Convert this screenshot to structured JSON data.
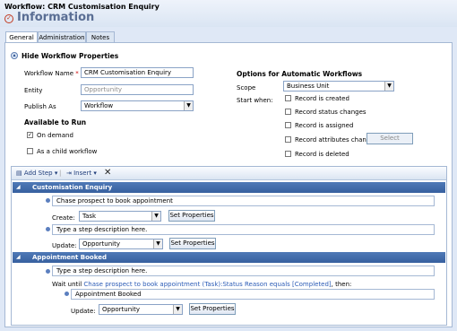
{
  "header": {
    "workflow_title": "Workflow: CRM Customisation Enquiry",
    "info_title": "Information"
  },
  "tabs": [
    {
      "label": "General"
    },
    {
      "label": "Administration"
    },
    {
      "label": "Notes"
    }
  ],
  "properties": {
    "section_label": "Hide Workflow Properties",
    "workflow_name_label": "Workflow Name",
    "required_mark": "*",
    "workflow_name_value": "CRM Customisation Enquiry",
    "entity_label": "Entity",
    "entity_value": "Opportunity",
    "publish_as_label": "Publish As",
    "publish_as_value": "Workflow",
    "available_header": "Available to Run",
    "on_demand_label": "On demand",
    "on_demand_checked": true,
    "child_label": "As a child workflow",
    "child_checked": false
  },
  "auto": {
    "header": "Options for Automatic Workflows",
    "scope_label": "Scope",
    "scope_value": "Business Unit",
    "start_when_label": "Start when:",
    "options": [
      {
        "label": "Record is created"
      },
      {
        "label": "Record status changes"
      },
      {
        "label": "Record is assigned"
      },
      {
        "label": "Record attributes change"
      },
      {
        "label": "Record is deleted"
      }
    ],
    "select_button": "Select"
  },
  "toolbar": {
    "add_step": "Add Step",
    "insert": "Insert"
  },
  "stages": [
    {
      "name": "Customisation Enquiry",
      "steps": [
        {
          "description": "Chase prospect to book appointment",
          "action_label": "Create:",
          "entity": "Task",
          "button": "Set Properties"
        },
        {
          "description": "Type a step description here.",
          "action_label": "Update:",
          "entity": "Opportunity",
          "button": "Set Properties"
        }
      ]
    },
    {
      "name": "Appointment Booked",
      "step_description": "Type a step description here.",
      "wait_prefix": "Wait until",
      "wait_condition": "Chase prospect to book appointment (Task):Status Reason equals [Completed]",
      "wait_suffix": ", then:",
      "inner_description": "Appointment Booked",
      "action_label": "Update:",
      "entity": "Opportunity",
      "button": "Set Properties"
    }
  ],
  "colors": {
    "background": "#dfe8f6",
    "stage_bar": "#4a73b0",
    "info_title": "#5a6e94",
    "link": "#2b5bb6"
  }
}
